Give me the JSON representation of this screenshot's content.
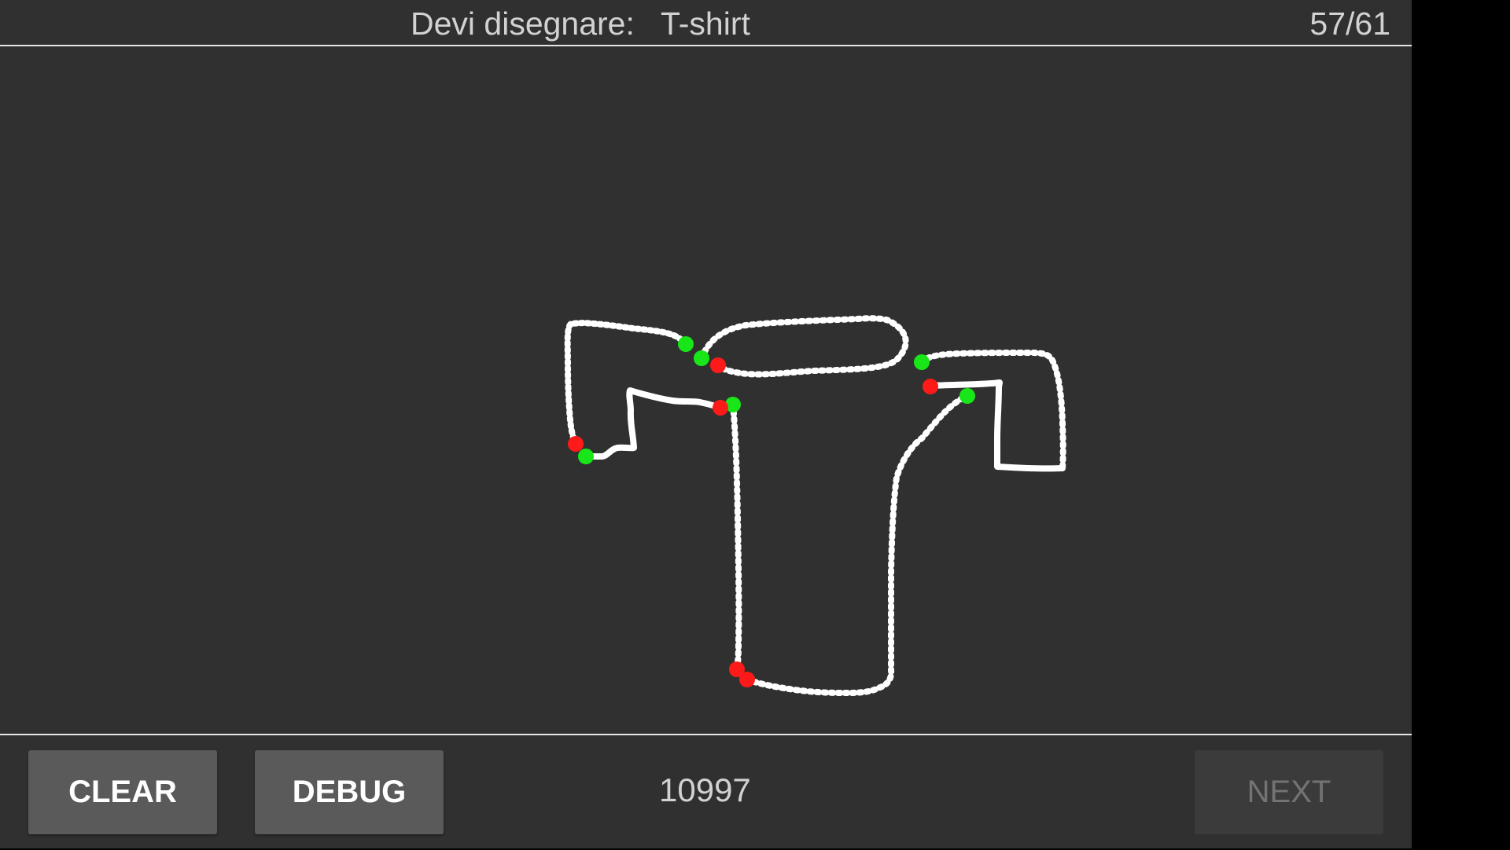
{
  "header": {
    "prompt_label": "Devi disegnare:",
    "prompt_word": "T-shirt",
    "progress": "57/61"
  },
  "drawing": {
    "ink_color": "#ffffff",
    "start_marker_color": "#19e619",
    "end_marker_color": "#ff1a1a",
    "background_color": "#303030",
    "stroke_count": 6
  },
  "footer": {
    "clear_label": "CLEAR",
    "debug_label": "DEBUG",
    "score": "10997",
    "next_label": "NEXT",
    "next_enabled": false
  }
}
